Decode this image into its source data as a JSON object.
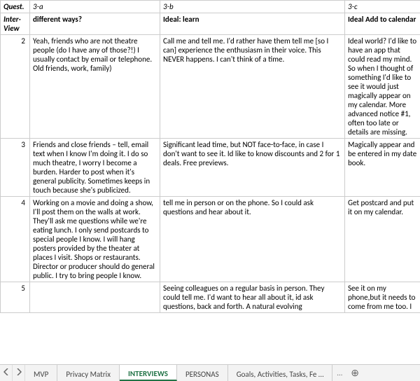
{
  "header": {
    "quest_label": "Quest.",
    "sub_label": "Inter-View",
    "col_codes": {
      "a": "3-a",
      "b": "3-b",
      "c": "3-c"
    },
    "col_titles": {
      "a": "different ways?",
      "b": "Ideal: learn",
      "c": "Ideal Add to calendar"
    }
  },
  "rows": [
    {
      "num": "2",
      "a": "Yeah, friends who are not theatre people (do I have any of those?!) I usually contact by email or telephone. Old friends, work, family)",
      "b": "Call me and tell me. I'd rather have them tell me [so I can] experience the enthusiasm in their voice. This NEVER happens. I can't think of a time.",
      "c": "Ideal world? I'd like to have an app that could read my mind. So when I thought of something I'd like to see it would just magically appear on my calendar. More advanced notice #1, often too late or details are missing."
    },
    {
      "num": "3",
      "a": "Friends and close friends – tell, email text when I know I'm doing it. I do so much theatre, I worry I become a burden. Harder to post when it's general publicity. Sometimes keeps in touch because she's publicized.",
      "b": "Significant lead time, but NOT face-to-face, in case I don't want to see it. Id like to know discounts and 2 for 1 deals. Free previews.",
      "c": "Magically appear and be entered in my date book."
    },
    {
      "num": "4",
      "a": "Working on a movie and doing a show, I'll post them on the walls at work. They'll ask me questions while we're eating lunch. I only send postcards to special people I know. I will hang posters provided by the theater at places I visit. Shops or restaurants. Director or producer should do general public. I try to bring people I know.",
      "b": "tell me in person or on the phone. So I could ask questions and hear about it.",
      "c": "Get postcard and put it on my calendar."
    },
    {
      "num": "5",
      "a": "",
      "b": "Seeing colleagues on a regular basis in person. They could tell me. I'd want to hear all about it, id ask questions, back and forth. A natural evolving",
      "c": "See it on my phone,but it needs to come from me too. I"
    }
  ],
  "tabs": {
    "items": [
      "MVP",
      "Privacy Matrix",
      "INTERVIEWS",
      "PERSONAS",
      "Goals, Activities, Tasks, Fe …"
    ],
    "active_index": 2,
    "more": "…"
  }
}
